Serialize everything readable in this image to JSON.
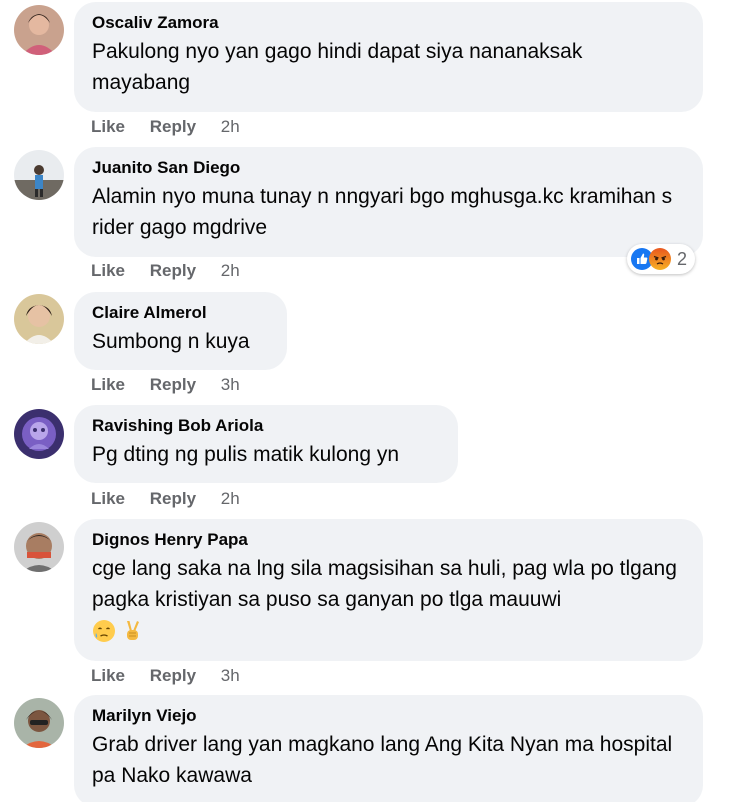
{
  "actions": {
    "like": "Like",
    "reply": "Reply"
  },
  "comments": [
    {
      "author": "Oscaliv Zamora",
      "text": "Pakulong nyo yan gago hindi dapat siya nananaksak mayabang",
      "time": "2h"
    },
    {
      "author": "Juanito San Diego",
      "text": "Alamin nyo muna tunay n nngyari bgo mghusga.kc kramihan s rider gago mgdrive",
      "time": "2h",
      "reactions": {
        "icons": [
          "like-reaction",
          "angry-reaction"
        ],
        "count": "2"
      }
    },
    {
      "author": "Claire Almerol",
      "text": "Sumbong n kuya",
      "time": "3h"
    },
    {
      "author": "Ravishing Bob Ariola",
      "text": "Pg dting ng pulis matik kulong yn",
      "time": "2h"
    },
    {
      "author": "Dignos Henry Papa",
      "text": "cge lang saka na lng sila magsisihan sa huli, pag wla po tlgang pagka kristiyan sa puso sa ganyan po tlga mauuwi",
      "emojis": [
        "sad-relieved-emoji",
        "victory-hand-emoji"
      ],
      "time": "3h"
    },
    {
      "author": "Marilyn Viejo",
      "text": "Grab driver lang yan magkano lang Ang Kita Nyan ma hospital pa Nako kawawa"
    }
  ]
}
